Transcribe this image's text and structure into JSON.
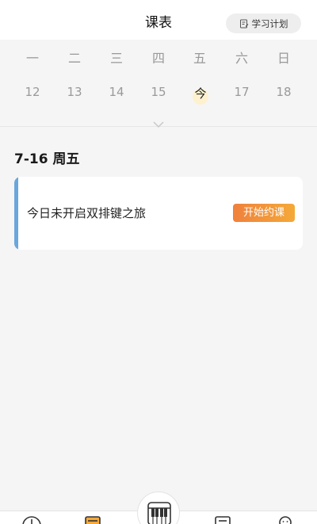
{
  "header": {
    "title": "课表",
    "plan_button_label": "学习计划"
  },
  "week": {
    "days": [
      "一",
      "二",
      "三",
      "四",
      "五",
      "六",
      "日"
    ],
    "dates": [
      "12",
      "13",
      "14",
      "15",
      "今",
      "17",
      "18"
    ],
    "today_index": 4
  },
  "schedule": {
    "date_heading": "7-16 周五",
    "card_text": "今日未开启双排键之旅",
    "start_button_label": "开始约课"
  },
  "colors": {
    "card_accent": "#6aa7dc",
    "button_gradient_start": "#f0813d",
    "button_gradient_end": "#f4a938",
    "today_highlight": "#fdf1cf"
  },
  "tabbar": {
    "icons": [
      "clock-icon",
      "schedule-icon",
      "piano-keyboard-icon",
      "list-icon",
      "profile-icon"
    ]
  }
}
